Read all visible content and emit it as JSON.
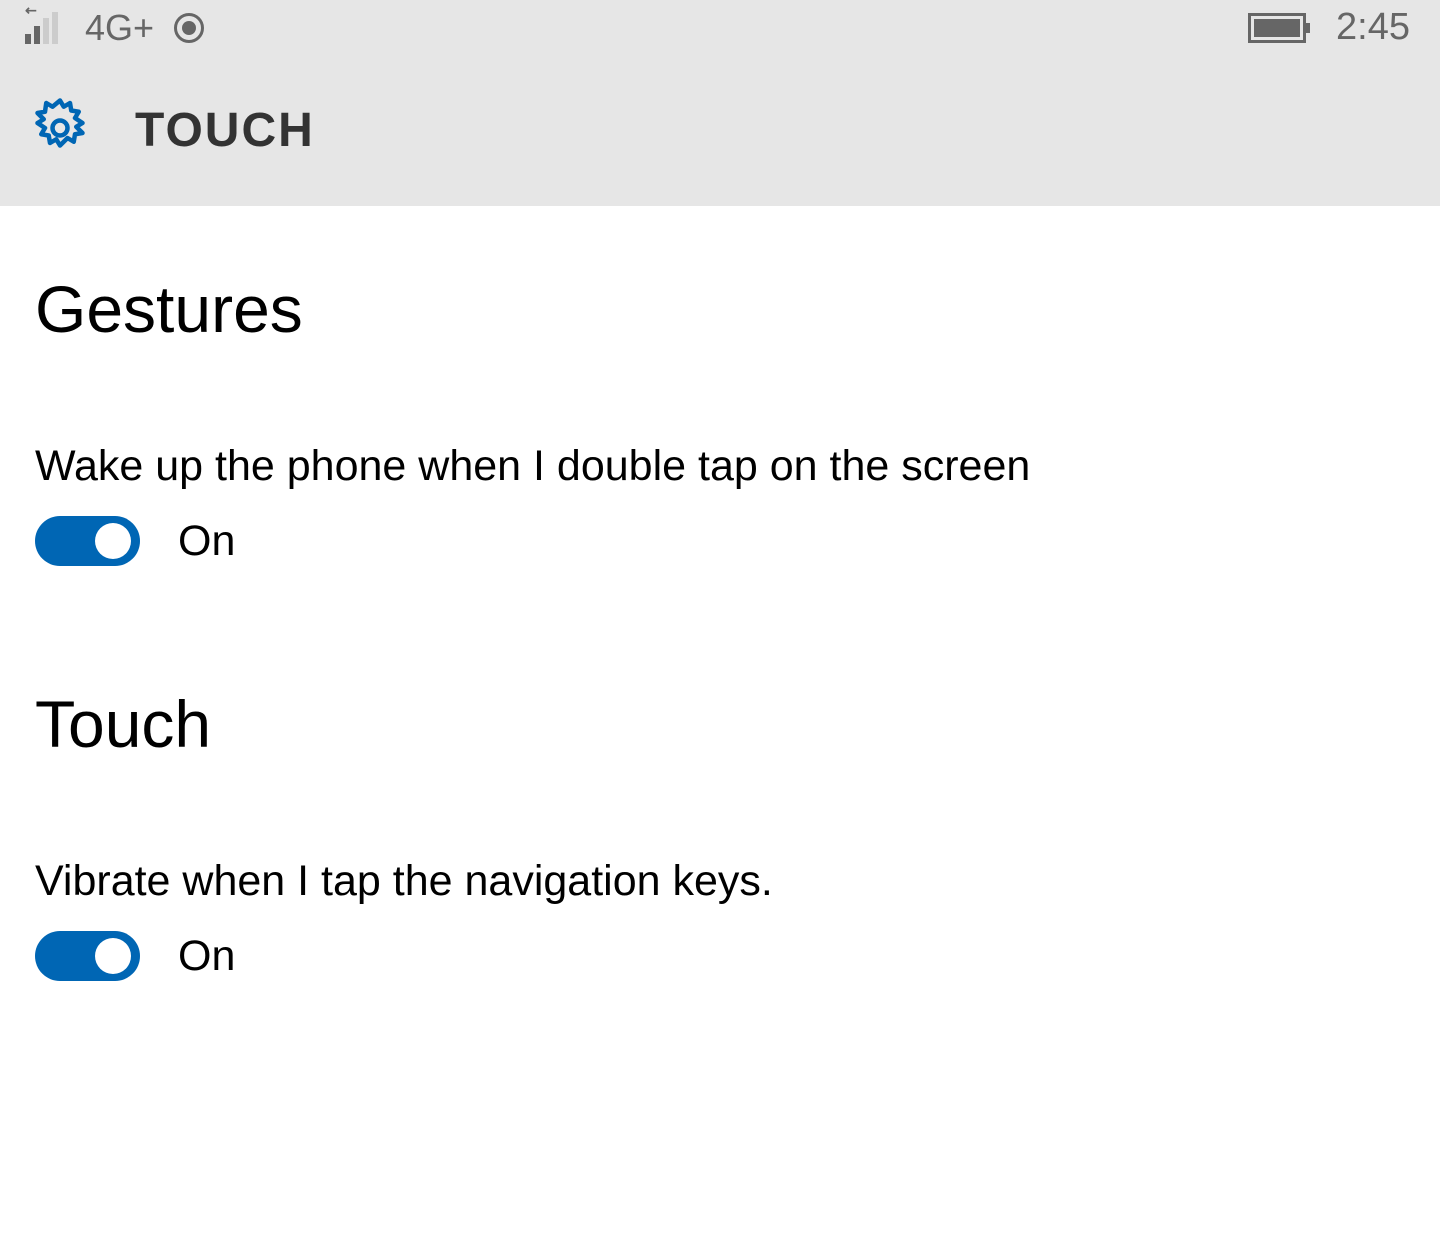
{
  "status_bar": {
    "network_label": "4G+",
    "clock": "2:45"
  },
  "header": {
    "title": "TOUCH"
  },
  "sections": {
    "gestures": {
      "heading": "Gestures",
      "setting_label": "Wake up the phone when I double tap on the screen",
      "toggle_state": "On"
    },
    "touch": {
      "heading": "Touch",
      "setting_label": "Vibrate when I tap the navigation keys.",
      "toggle_state": "On"
    }
  },
  "colors": {
    "accent": "#0066b4",
    "header_bg": "#e6e6e6",
    "status_text": "#666666"
  }
}
